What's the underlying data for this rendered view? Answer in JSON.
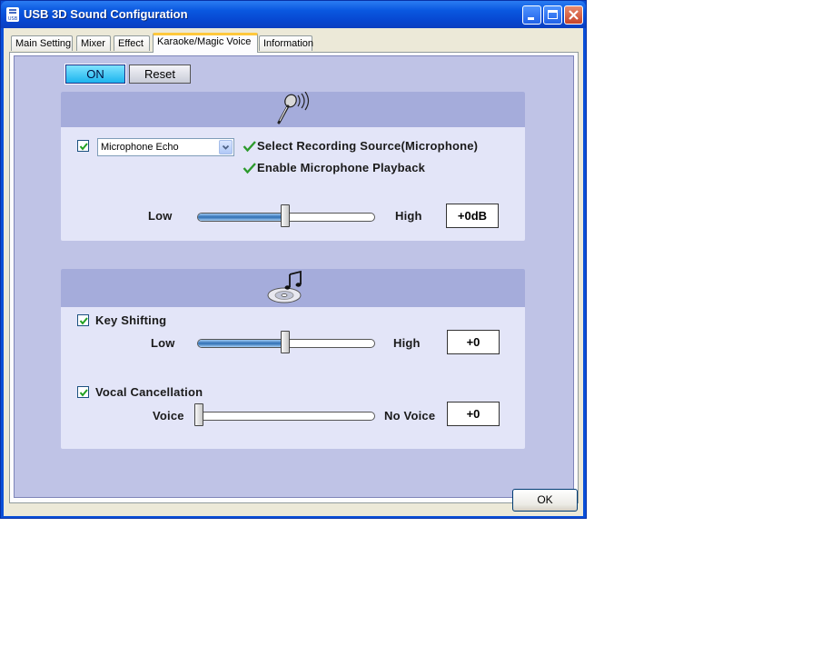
{
  "window": {
    "title": "USB 3D Sound Configuration"
  },
  "tabs": [
    {
      "label": "Main Setting",
      "active": false
    },
    {
      "label": "Mixer",
      "active": false
    },
    {
      "label": "Effect",
      "active": false
    },
    {
      "label": "Karaoke/Magic Voice",
      "active": true
    },
    {
      "label": "Information",
      "active": false
    }
  ],
  "controls": {
    "on_label": "ON",
    "reset_label": "Reset"
  },
  "mic_group": {
    "icon": "microphone-icon",
    "echo_enabled": true,
    "echo_select_value": "Microphone Echo",
    "select_source_label": "Select Recording Source(Microphone)",
    "enable_playback_label": "Enable Microphone Playback",
    "low_label": "Low",
    "high_label": "High",
    "level_value": "+0dB",
    "level_fraction": 0.5
  },
  "music_group": {
    "icon": "music-cd-icon",
    "key_shift": {
      "enabled": true,
      "label": "Key Shifting",
      "low_label": "Low",
      "high_label": "High",
      "value": "+0",
      "fraction": 0.5
    },
    "vocal_cancel": {
      "enabled": true,
      "label": "Vocal Cancellation",
      "low_label": "Voice",
      "high_label": "No Voice",
      "value": "+0",
      "fraction": 0.0
    }
  },
  "footer": {
    "ok_label": "OK"
  },
  "colors": {
    "panel": "#bfc3e6",
    "group_header": "#a5acdb",
    "group_body": "#e3e5f8",
    "on_button": "#1cb4ee",
    "titlebar": "#0a58e0"
  }
}
